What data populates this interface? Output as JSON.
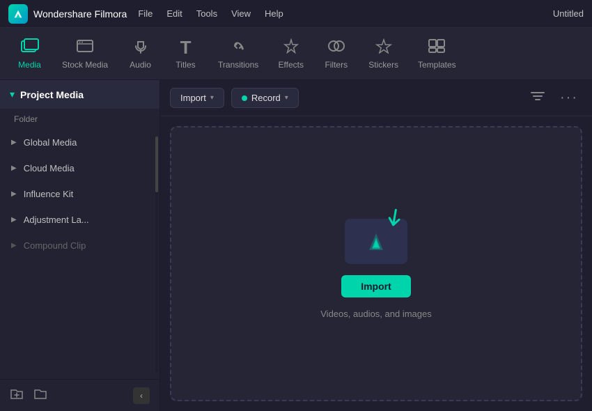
{
  "titleBar": {
    "appName": "Wondershare Filmora",
    "menuItems": [
      "File",
      "Edit",
      "Tools",
      "View",
      "Help"
    ],
    "projectTitle": "Untitled"
  },
  "tabs": [
    {
      "id": "media",
      "label": "Media",
      "icon": "🖼",
      "active": true
    },
    {
      "id": "stock-media",
      "label": "Stock Media",
      "icon": "📁",
      "active": false
    },
    {
      "id": "audio",
      "label": "Audio",
      "icon": "🎵",
      "active": false
    },
    {
      "id": "titles",
      "label": "Titles",
      "icon": "T",
      "active": false
    },
    {
      "id": "transitions",
      "label": "Transitions",
      "icon": "↔",
      "active": false
    },
    {
      "id": "effects",
      "label": "Effects",
      "icon": "✨",
      "active": false
    },
    {
      "id": "filters",
      "label": "Filters",
      "icon": "🔵",
      "active": false
    },
    {
      "id": "stickers",
      "label": "Stickers",
      "icon": "✦",
      "active": false
    },
    {
      "id": "templates",
      "label": "Templates",
      "icon": "⊞",
      "active": false
    }
  ],
  "sidebar": {
    "header": {
      "title": "Project Media",
      "arrow": "▾"
    },
    "folderLabel": "Folder",
    "items": [
      {
        "id": "global-media",
        "label": "Global Media"
      },
      {
        "id": "cloud-media",
        "label": "Cloud Media"
      },
      {
        "id": "influence-kit",
        "label": "Influence Kit"
      },
      {
        "id": "adjustment-la",
        "label": "Adjustment La..."
      },
      {
        "id": "compound-clip",
        "label": "Compound Clip"
      }
    ],
    "bottomIcons": {
      "addFolder": "📁+",
      "newFolder": "📂"
    },
    "collapseBtn": "‹"
  },
  "contentArea": {
    "toolbar": {
      "importLabel": "Import",
      "recordLabel": "Record",
      "filterIcon": "filter",
      "moreIcon": "more"
    },
    "dropZone": {
      "importBtnLabel": "Import",
      "descriptionText": "Videos, audios, and images"
    }
  }
}
